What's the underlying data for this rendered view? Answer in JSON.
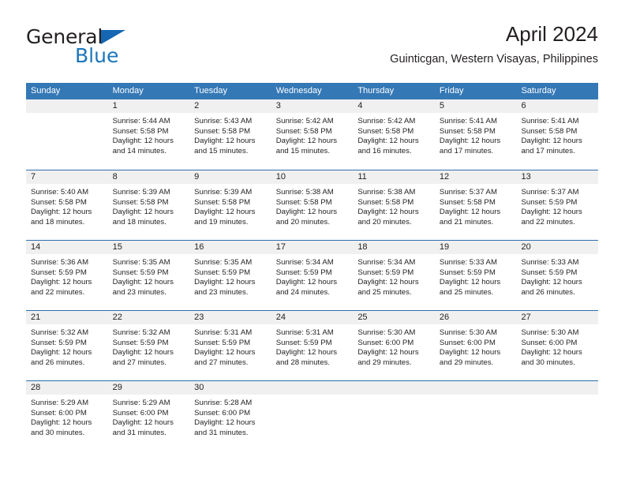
{
  "brand": {
    "name_dark": "General",
    "name_light": "Blue",
    "triangle_color": "#1567b3",
    "blue_color": "#1b75bb"
  },
  "header": {
    "title": "April 2024",
    "subtitle": "Guinticgan, Western Visayas, Philippines"
  },
  "colors": {
    "header_blue": "#3478b6",
    "week_divider": "#2f6fad",
    "day_band_gray": "#f0f0f0",
    "text": "#231f20"
  },
  "weekdays": [
    "Sunday",
    "Monday",
    "Tuesday",
    "Wednesday",
    "Thursday",
    "Friday",
    "Saturday"
  ],
  "weeks": [
    {
      "days": [
        {
          "num": "",
          "empty": true,
          "l1": "",
          "l2": "",
          "l3": "",
          "l4": ""
        },
        {
          "num": "1",
          "l1": "Sunrise: 5:44 AM",
          "l2": "Sunset: 5:58 PM",
          "l3": "Daylight: 12 hours",
          "l4": "and 14 minutes."
        },
        {
          "num": "2",
          "l1": "Sunrise: 5:43 AM",
          "l2": "Sunset: 5:58 PM",
          "l3": "Daylight: 12 hours",
          "l4": "and 15 minutes."
        },
        {
          "num": "3",
          "l1": "Sunrise: 5:42 AM",
          "l2": "Sunset: 5:58 PM",
          "l3": "Daylight: 12 hours",
          "l4": "and 15 minutes."
        },
        {
          "num": "4",
          "l1": "Sunrise: 5:42 AM",
          "l2": "Sunset: 5:58 PM",
          "l3": "Daylight: 12 hours",
          "l4": "and 16 minutes."
        },
        {
          "num": "5",
          "l1": "Sunrise: 5:41 AM",
          "l2": "Sunset: 5:58 PM",
          "l3": "Daylight: 12 hours",
          "l4": "and 17 minutes."
        },
        {
          "num": "6",
          "l1": "Sunrise: 5:41 AM",
          "l2": "Sunset: 5:58 PM",
          "l3": "Daylight: 12 hours",
          "l4": "and 17 minutes."
        }
      ]
    },
    {
      "days": [
        {
          "num": "7",
          "l1": "Sunrise: 5:40 AM",
          "l2": "Sunset: 5:58 PM",
          "l3": "Daylight: 12 hours",
          "l4": "and 18 minutes."
        },
        {
          "num": "8",
          "l1": "Sunrise: 5:39 AM",
          "l2": "Sunset: 5:58 PM",
          "l3": "Daylight: 12 hours",
          "l4": "and 18 minutes."
        },
        {
          "num": "9",
          "l1": "Sunrise: 5:39 AM",
          "l2": "Sunset: 5:58 PM",
          "l3": "Daylight: 12 hours",
          "l4": "and 19 minutes."
        },
        {
          "num": "10",
          "l1": "Sunrise: 5:38 AM",
          "l2": "Sunset: 5:58 PM",
          "l3": "Daylight: 12 hours",
          "l4": "and 20 minutes."
        },
        {
          "num": "11",
          "l1": "Sunrise: 5:38 AM",
          "l2": "Sunset: 5:58 PM",
          "l3": "Daylight: 12 hours",
          "l4": "and 20 minutes."
        },
        {
          "num": "12",
          "l1": "Sunrise: 5:37 AM",
          "l2": "Sunset: 5:58 PM",
          "l3": "Daylight: 12 hours",
          "l4": "and 21 minutes."
        },
        {
          "num": "13",
          "l1": "Sunrise: 5:37 AM",
          "l2": "Sunset: 5:59 PM",
          "l3": "Daylight: 12 hours",
          "l4": "and 22 minutes."
        }
      ]
    },
    {
      "days": [
        {
          "num": "14",
          "l1": "Sunrise: 5:36 AM",
          "l2": "Sunset: 5:59 PM",
          "l3": "Daylight: 12 hours",
          "l4": "and 22 minutes."
        },
        {
          "num": "15",
          "l1": "Sunrise: 5:35 AM",
          "l2": "Sunset: 5:59 PM",
          "l3": "Daylight: 12 hours",
          "l4": "and 23 minutes."
        },
        {
          "num": "16",
          "l1": "Sunrise: 5:35 AM",
          "l2": "Sunset: 5:59 PM",
          "l3": "Daylight: 12 hours",
          "l4": "and 23 minutes."
        },
        {
          "num": "17",
          "l1": "Sunrise: 5:34 AM",
          "l2": "Sunset: 5:59 PM",
          "l3": "Daylight: 12 hours",
          "l4": "and 24 minutes."
        },
        {
          "num": "18",
          "l1": "Sunrise: 5:34 AM",
          "l2": "Sunset: 5:59 PM",
          "l3": "Daylight: 12 hours",
          "l4": "and 25 minutes."
        },
        {
          "num": "19",
          "l1": "Sunrise: 5:33 AM",
          "l2": "Sunset: 5:59 PM",
          "l3": "Daylight: 12 hours",
          "l4": "and 25 minutes."
        },
        {
          "num": "20",
          "l1": "Sunrise: 5:33 AM",
          "l2": "Sunset: 5:59 PM",
          "l3": "Daylight: 12 hours",
          "l4": "and 26 minutes."
        }
      ]
    },
    {
      "days": [
        {
          "num": "21",
          "l1": "Sunrise: 5:32 AM",
          "l2": "Sunset: 5:59 PM",
          "l3": "Daylight: 12 hours",
          "l4": "and 26 minutes."
        },
        {
          "num": "22",
          "l1": "Sunrise: 5:32 AM",
          "l2": "Sunset: 5:59 PM",
          "l3": "Daylight: 12 hours",
          "l4": "and 27 minutes."
        },
        {
          "num": "23",
          "l1": "Sunrise: 5:31 AM",
          "l2": "Sunset: 5:59 PM",
          "l3": "Daylight: 12 hours",
          "l4": "and 27 minutes."
        },
        {
          "num": "24",
          "l1": "Sunrise: 5:31 AM",
          "l2": "Sunset: 5:59 PM",
          "l3": "Daylight: 12 hours",
          "l4": "and 28 minutes."
        },
        {
          "num": "25",
          "l1": "Sunrise: 5:30 AM",
          "l2": "Sunset: 6:00 PM",
          "l3": "Daylight: 12 hours",
          "l4": "and 29 minutes."
        },
        {
          "num": "26",
          "l1": "Sunrise: 5:30 AM",
          "l2": "Sunset: 6:00 PM",
          "l3": "Daylight: 12 hours",
          "l4": "and 29 minutes."
        },
        {
          "num": "27",
          "l1": "Sunrise: 5:30 AM",
          "l2": "Sunset: 6:00 PM",
          "l3": "Daylight: 12 hours",
          "l4": "and 30 minutes."
        }
      ]
    },
    {
      "days": [
        {
          "num": "28",
          "l1": "Sunrise: 5:29 AM",
          "l2": "Sunset: 6:00 PM",
          "l3": "Daylight: 12 hours",
          "l4": "and 30 minutes."
        },
        {
          "num": "29",
          "l1": "Sunrise: 5:29 AM",
          "l2": "Sunset: 6:00 PM",
          "l3": "Daylight: 12 hours",
          "l4": "and 31 minutes."
        },
        {
          "num": "30",
          "l1": "Sunrise: 5:28 AM",
          "l2": "Sunset: 6:00 PM",
          "l3": "Daylight: 12 hours",
          "l4": "and 31 minutes."
        },
        {
          "num": "",
          "empty": true,
          "l1": "",
          "l2": "",
          "l3": "",
          "l4": ""
        },
        {
          "num": "",
          "empty": true,
          "l1": "",
          "l2": "",
          "l3": "",
          "l4": ""
        },
        {
          "num": "",
          "empty": true,
          "l1": "",
          "l2": "",
          "l3": "",
          "l4": ""
        },
        {
          "num": "",
          "empty": true,
          "l1": "",
          "l2": "",
          "l3": "",
          "l4": ""
        }
      ]
    }
  ]
}
